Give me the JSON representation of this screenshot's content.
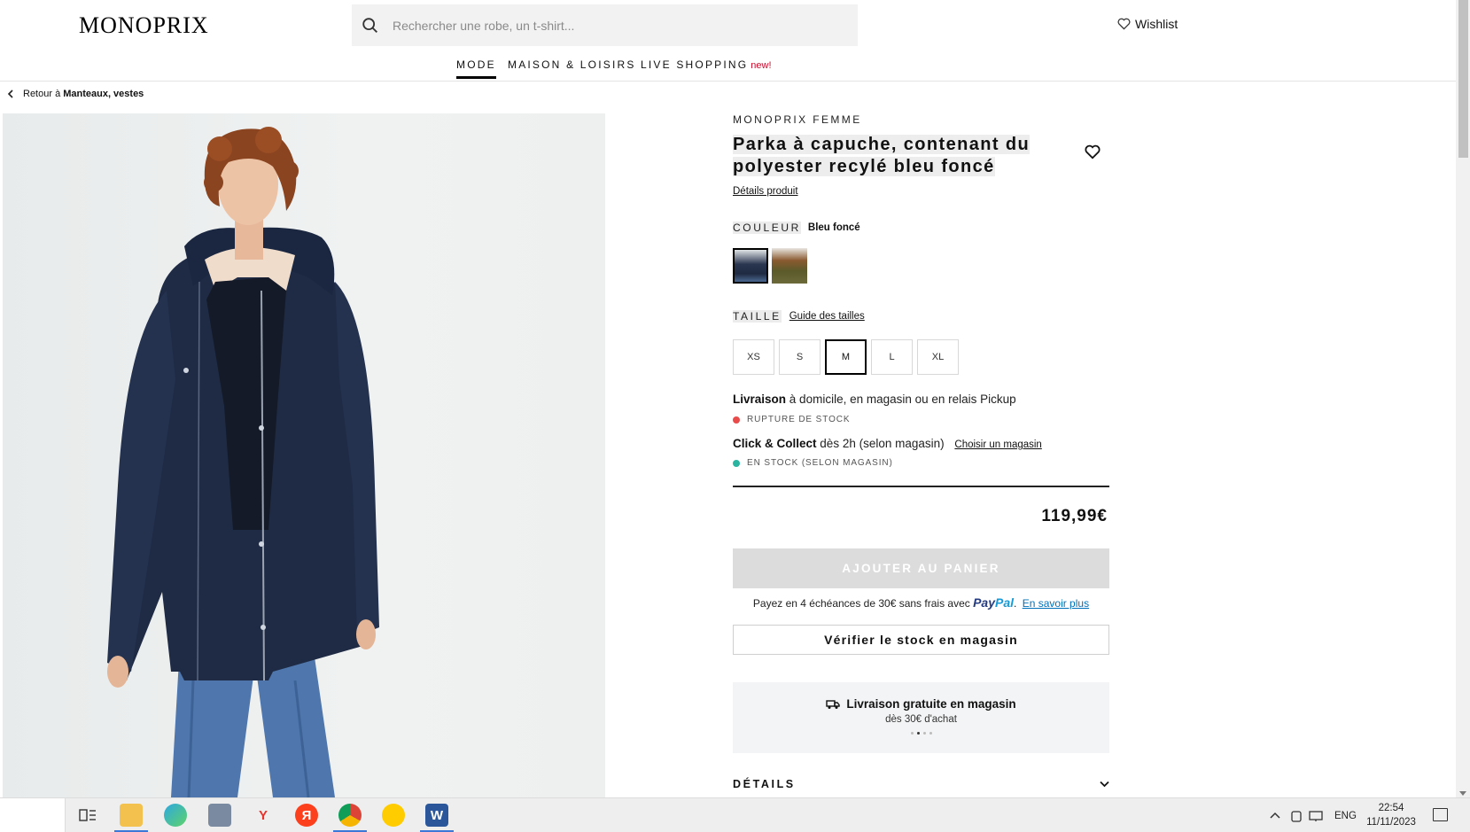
{
  "header": {
    "logo": "MONOPRIX",
    "search_placeholder": "Rechercher une robe, un t-shirt...",
    "wishlist_label": "Wishlist"
  },
  "nav": {
    "items": [
      {
        "label": "MODE"
      },
      {
        "label": "MAISON & LOISIRS"
      },
      {
        "label": "LIVE SHOPPING"
      }
    ],
    "new_badge": "new!"
  },
  "breadcrumb": {
    "prefix": "Retour à",
    "target": "Manteaux, vestes"
  },
  "product": {
    "brand": "MONOPRIX FEMME",
    "title": "Parka à capuche, contenant du polyester recylé bleu foncé",
    "details_link": "Détails produit",
    "color_label": "COULEUR",
    "color_value": "Bleu foncé",
    "size_label": "TAILLE",
    "size_guide": "Guide des tailles",
    "sizes": [
      "XS",
      "S",
      "M",
      "L",
      "XL"
    ],
    "selected_size": "M"
  },
  "availability": {
    "delivery_bold": "Livraison",
    "delivery_text": "à domicile, en magasin ou en relais Pickup",
    "delivery_status": "RUPTURE DE STOCK",
    "delivery_status_color": "#e94b4b",
    "click_bold": "Click & Collect",
    "click_text": "dès 2h (selon magasin)",
    "choose_store": "Choisir un magasin",
    "click_status": "EN STOCK (SELON MAGASIN)",
    "click_status_color": "#2bb5a0"
  },
  "purchase": {
    "price": "119,99€",
    "add_to_cart": "AJOUTER AU PANIER",
    "paypal_text": "Payez en 4 échéances de 30€ sans frais avec",
    "paypal_logo_1": "Pay",
    "paypal_logo_2": "Pal",
    "paypal_more": "En savoir plus",
    "check_stock": "Vérifier le stock en magasin"
  },
  "promo": {
    "title": "Livraison gratuite en magasin",
    "subtitle": "dès 30€ d'achat"
  },
  "accordion": {
    "details": "DÉTAILS"
  },
  "taskbar": {
    "lang": "ENG",
    "time": "22:54",
    "date": "11/11/2023"
  }
}
